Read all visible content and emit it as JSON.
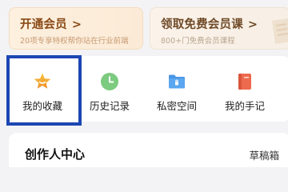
{
  "promos": {
    "vip": {
      "title": "开通会员",
      "chevron": ">",
      "subtitle": "20项专享特权帮你站在行业前端"
    },
    "free_course": {
      "title": "领取免费会员课",
      "chevron": ">",
      "subtitle": "800+门免费会员课程"
    }
  },
  "quick_access": [
    {
      "label": "我的收藏",
      "icon": "star-icon",
      "color": "#f0a530"
    },
    {
      "label": "历史记录",
      "icon": "clock-icon",
      "color": "#7ccb80"
    },
    {
      "label": "私密空间",
      "icon": "folder-lock-icon",
      "color": "#4a96e6"
    },
    {
      "label": "我的手记",
      "icon": "notebook-icon",
      "color": "#ee6a4f"
    }
  ],
  "creator": {
    "title": "创作人中心",
    "drafts_label": "草稿箱"
  },
  "colors": {
    "highlight": "#1c46b4",
    "vip_text": "#8a4a16"
  }
}
